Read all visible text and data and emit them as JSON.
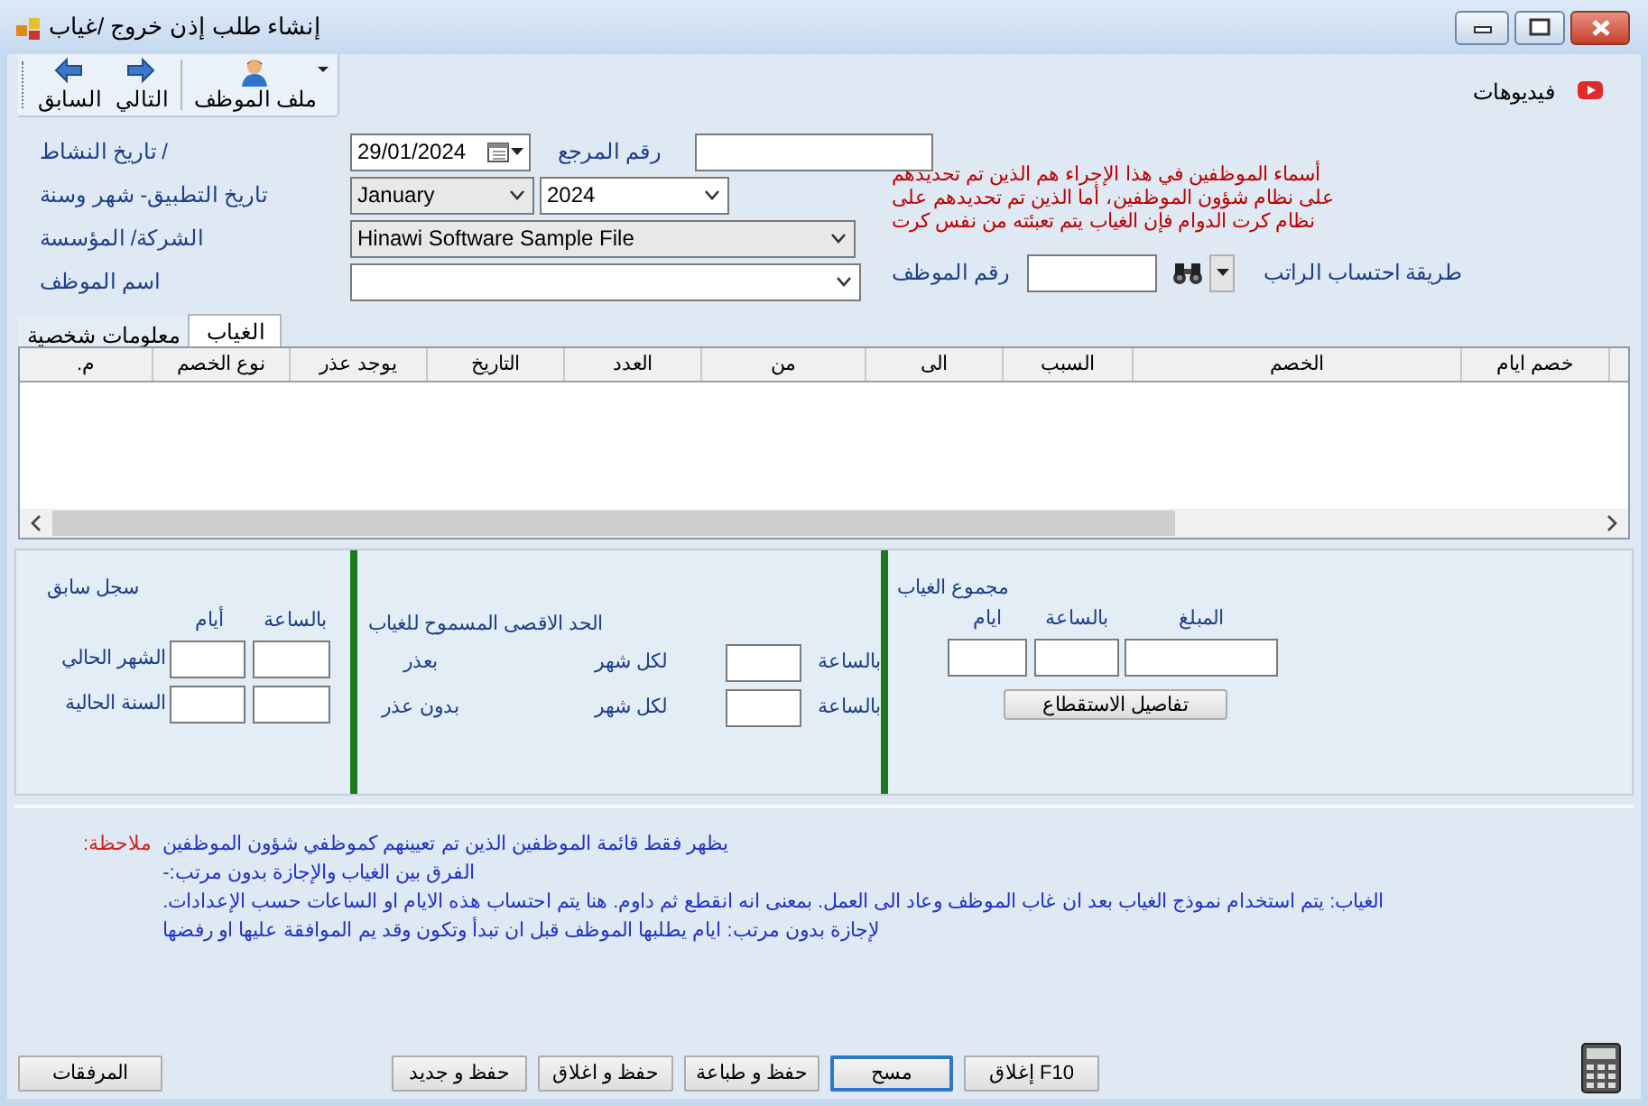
{
  "window": {
    "title": "إنشاء طلب إذن خروج /غياب"
  },
  "toolbar": {
    "buttons": [
      {
        "label": "ملف الموظف",
        "kind": "profile"
      },
      {
        "label": "التالي",
        "kind": "next"
      },
      {
        "label": "السابق",
        "kind": "back"
      }
    ],
    "videos_link": "فيديوهات"
  },
  "form": {
    "activity_date": {
      "label": "/ تاريخ النشاط",
      "value": "29/01/2024"
    },
    "reference_no": {
      "label": "رقم المرجع"
    },
    "application_period": {
      "label": "تاريخ التطبيق- شهر وسنة",
      "month": "January",
      "year": "2024"
    },
    "company": {
      "label": "الشركة/ المؤسسة",
      "value": "Hinawi Software Sample File"
    },
    "employee_name": {
      "label": "اسم الموظف"
    },
    "employee_no": {
      "label": "رقم الموظف"
    },
    "salary_method": {
      "label": "طريقة احتساب الراتب"
    },
    "notice": [
      "أسماء الموظفين في هذا الإجراء هم الذين تم تحديدهم",
      "على نظام شؤون الموظفين،  أما الذين تم تحديدهم على",
      "نظام كرت الدوام فإن الغياب يتم تعبئته من نفس كرت"
    ]
  },
  "tabs": [
    {
      "label": "الغياب",
      "selected": true
    },
    {
      "label": "معلومات شخصية",
      "selected": false
    }
  ],
  "table": {
    "columns": [
      "خصم ايام",
      "الخصم",
      "السبب",
      "الى",
      "من",
      "العدد",
      "التاريخ",
      "يوجد عذر",
      "نوع الخصم",
      "م."
    ]
  },
  "summary": {
    "previous_record": {
      "title": "سجل سابق",
      "columns": [
        "بالساعة",
        "أيام"
      ],
      "rows": [
        "الشهر الحالي",
        "السنة الحالية"
      ]
    },
    "max_allowed": {
      "title": "الحد الاقصى المسموح للغياب",
      "rows": [
        {
          "label": "بعذر",
          "period": "لكل شهر",
          "unit": "بالساعة"
        },
        {
          "label": "بدون عذر",
          "period": "لكل شهر",
          "unit": "بالساعة"
        }
      ]
    },
    "total_absence": {
      "title": "مجموع الغياب",
      "columns": [
        "المبلغ",
        "بالساعة",
        "ايام"
      ],
      "details_button": "تفاصيل الاستقطاع"
    }
  },
  "notes": {
    "label": "ملاحظة:",
    "lines": [
      "يظهر فقط قائمة الموظفين الذين تم تعيينهم كموظفي شؤون الموظفين",
      "الفرق بين الغياب والإجازة بدون مرتب:-",
      "الغياب: يتم استخدام نموذج الغياب بعد ان غاب الموظف وعاد الى العمل. بمعنى انه انقطع ثم داوم. هنا يتم احتساب هذه الايام او الساعات حسب الإعدادات.",
      "لإجازة بدون مرتب: ايام يطلبها الموظف قبل ان تبدأ وتكون وقد يم الموافقة عليها او رفضها"
    ]
  },
  "buttons": [
    {
      "label": "F10 إغلاق",
      "default": false
    },
    {
      "label": "مسح",
      "default": true
    },
    {
      "label": "حفظ و طباعة",
      "default": false
    },
    {
      "label": "حفظ و اغلاق",
      "default": false
    },
    {
      "label": "حفظ و جديد",
      "default": false
    },
    {
      "label": "المرفقات",
      "default": false
    }
  ]
}
